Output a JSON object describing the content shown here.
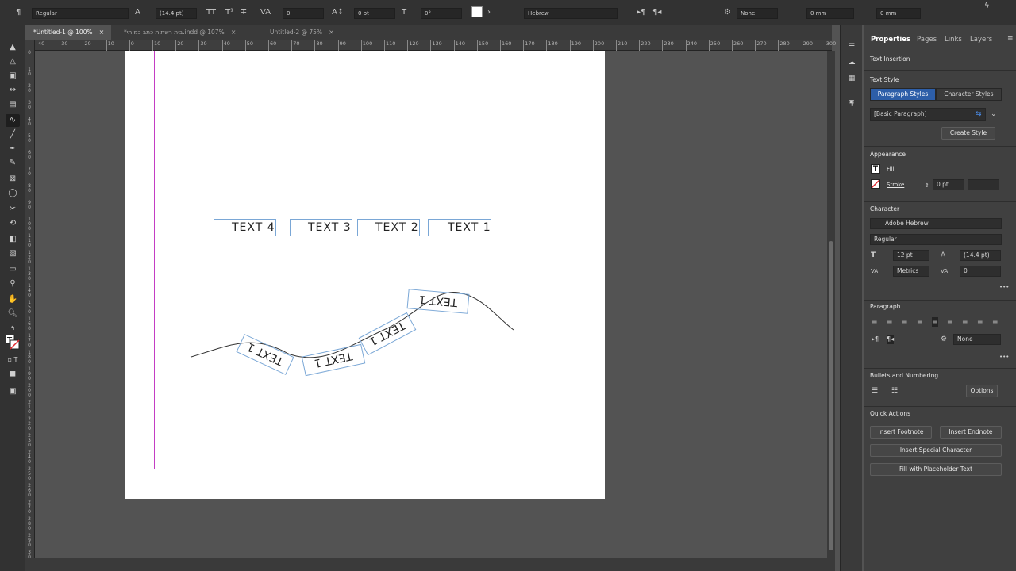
{
  "control_bar": {
    "font_style": "Regular",
    "leading": "(14.4 pt)",
    "kerning": "0",
    "baseline_shift": "0 pt",
    "skew": "0°",
    "language": "Hebrew",
    "composer": "None",
    "indent_before": "0 mm",
    "indent_after": "0 mm"
  },
  "tabs": [
    {
      "label": "*Untitled-1 @ 100%",
      "close": "×"
    },
    {
      "label": "*בית רשתות כתב כמותי.indd @ 107%",
      "close": "×"
    },
    {
      "label": "Untitled-2 @ 75%",
      "close": "×"
    }
  ],
  "ruler": {
    "h_ticks": [
      "40",
      "30",
      "20",
      "10",
      "0",
      "10",
      "20",
      "30",
      "40",
      "50",
      "60",
      "70",
      "80",
      "90",
      "100",
      "110",
      "120",
      "130",
      "140",
      "150",
      "160",
      "170",
      "180",
      "190",
      "200",
      "210",
      "220",
      "230",
      "240",
      "250",
      "260",
      "270",
      "280",
      "290",
      "300"
    ],
    "v_ticks": [
      "0",
      "10",
      "20",
      "30",
      "40",
      "50",
      "60",
      "70",
      "80",
      "90",
      "100",
      "110",
      "120",
      "130",
      "140",
      "150",
      "160",
      "170",
      "180",
      "190",
      "200",
      "210",
      "220",
      "230",
      "240",
      "250",
      "260",
      "270",
      "280",
      "290",
      "300"
    ]
  },
  "canvas": {
    "frames": [
      "TEXT 4",
      "TEXT 3",
      "TEXT 2",
      "TEXT 1"
    ],
    "path_text": [
      "TEXT 1",
      "TEXT 1",
      "TEXT 1",
      "TEXT 1"
    ]
  },
  "panel": {
    "tabs": [
      "Properties",
      "Pages",
      "Links",
      "Layers"
    ],
    "text_insertion": "Text Insertion",
    "text_style": {
      "title": "Text Style",
      "paragraph_styles": "Paragraph Styles",
      "character_styles": "Character Styles",
      "style_value": "[Basic Paragraph]",
      "create_style": "Create Style"
    },
    "appearance": {
      "title": "Appearance",
      "fill": "Fill",
      "stroke": "Stroke",
      "stroke_weight": "0 pt"
    },
    "character": {
      "title": "Character",
      "font": "Adobe Hebrew",
      "style": "Regular",
      "size": "12 pt",
      "leading": "(14.4 pt)",
      "kerning": "Metrics",
      "tracking": "0"
    },
    "paragraph": {
      "title": "Paragraph",
      "composer": "None"
    },
    "bullets": {
      "title": "Bullets and Numbering",
      "options": "Options"
    },
    "quick_actions": {
      "title": "Quick Actions",
      "insert_footnote": "Insert Footnote",
      "insert_endnote": "Insert Endnote",
      "insert_special_character": "Insert Special Character",
      "fill_placeholder": "Fill with Placeholder Text"
    },
    "more": "•••"
  },
  "colors": {
    "accent_blue": "#2d6fd2",
    "frame_blue": "#7aa7d6",
    "margin_magenta": "#c43dc4"
  }
}
